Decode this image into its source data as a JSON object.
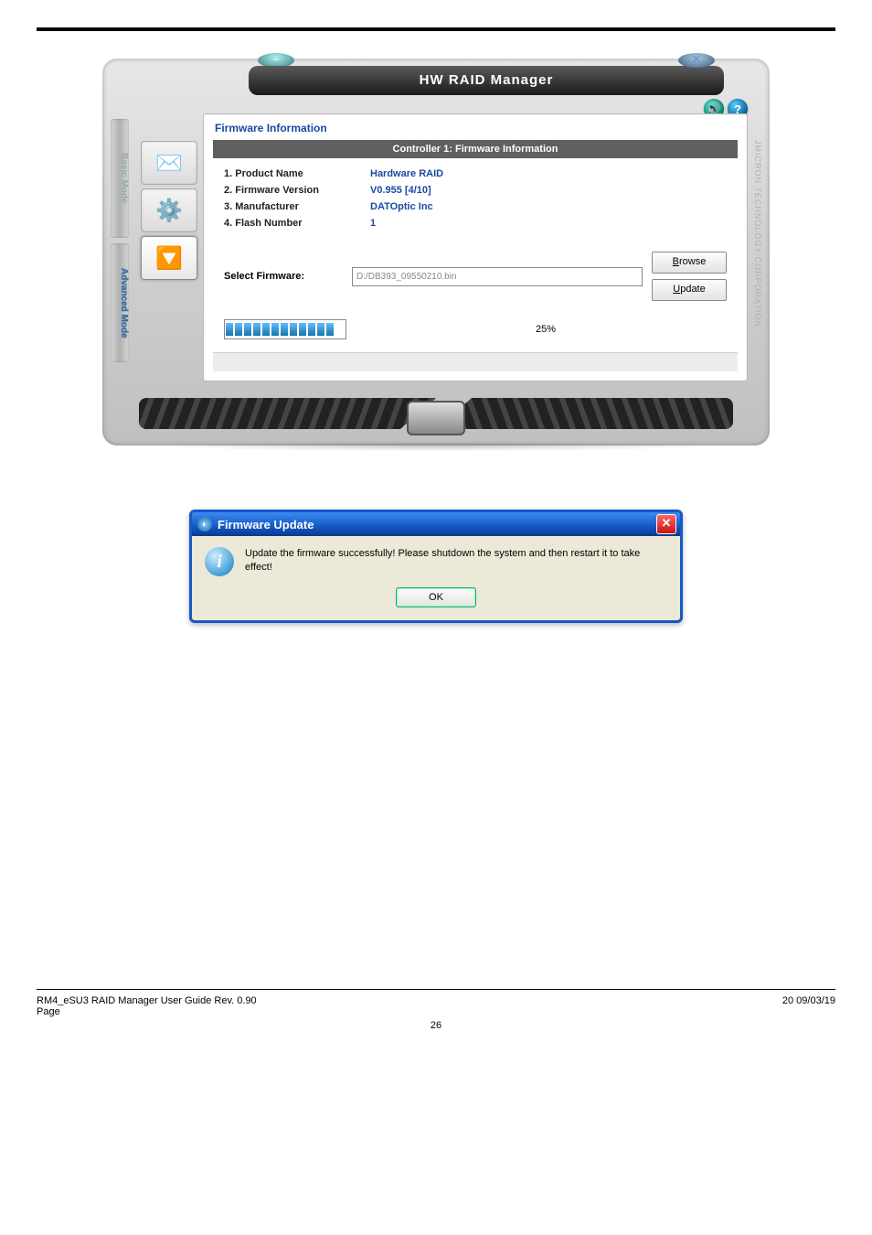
{
  "app": {
    "title": "HW RAID Manager",
    "vendor_side": "JMICRON TECHNOLOGY CORPORATION",
    "mode_basic": "Basic Mode",
    "mode_advanced": "Advanced Mode"
  },
  "panel": {
    "section_title": "Firmware Information",
    "ctrl_header": "Controller 1: Firmware Information",
    "rows": [
      {
        "label": "1.  Product Name",
        "value": "Hardware RAID"
      },
      {
        "label": "2.  Firmware Version",
        "value": "V0.955 [4/10]"
      },
      {
        "label": "3.  Manufacturer",
        "value": "DATOptic Inc"
      },
      {
        "label": "4.  Flash Number",
        "value": "1"
      }
    ],
    "select_label": "Select Firmware:",
    "select_value": "D:/DB393_09550210.bin",
    "btn_browse_pre": "B",
    "btn_browse_rest": "rowse",
    "btn_update_pre": "U",
    "btn_update_rest": "pdate",
    "progress_pct": "25%"
  },
  "dialog": {
    "title": "Firmware Update",
    "message": "Update the firmware successfully! Please shutdown the system and then restart it to take effect!",
    "ok": "OK"
  },
  "footer": {
    "left": "RM4_eSU3 RAID Manager User Guide Rev. 0.90",
    "right": "20  09/03/19",
    "page_label": " Page",
    "page_num": "26"
  }
}
